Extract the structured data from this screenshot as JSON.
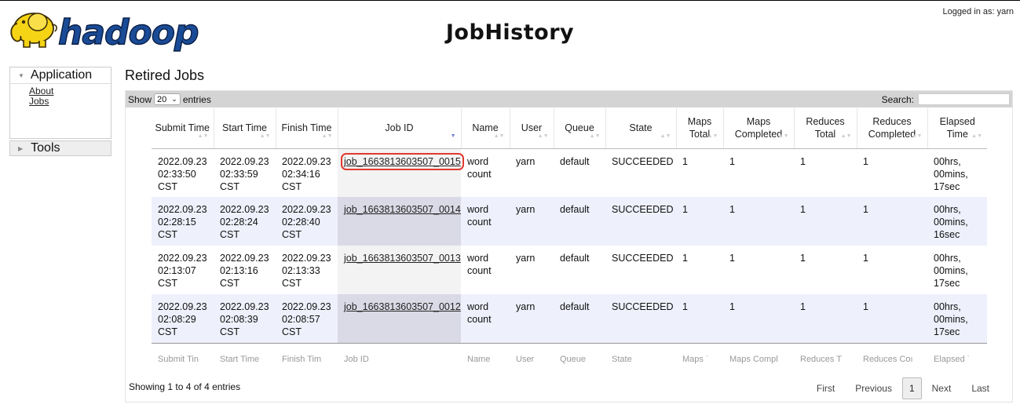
{
  "header": {
    "logo_text": "hadoop",
    "title": "JobHistory",
    "logged_in": "Logged in as: yarn"
  },
  "nav": {
    "application": "Application",
    "links": [
      "About",
      "Jobs"
    ],
    "tools": "Tools"
  },
  "main": {
    "title": "Retired Jobs",
    "show_label": "Show",
    "entries_value": "20",
    "entries_label": "entries",
    "search_label": "Search:"
  },
  "table": {
    "columns": [
      "Submit Time",
      "Start Time",
      "Finish Time",
      "Job ID",
      "Name",
      "User",
      "Queue",
      "State",
      "Maps Total",
      "Maps Completed",
      "Reduces Total",
      "Reduces Completed",
      "Elapsed Time"
    ],
    "footer": [
      "Submit Tin",
      "Start Time",
      "Finish Tim",
      "Job ID",
      "Name",
      "User",
      "Queue",
      "State",
      "Maps ˙",
      "Maps Compl",
      "Reduces T",
      "Reduces Coı",
      "Elapsed ˙"
    ],
    "rows": [
      {
        "submit": [
          "2022.09.23",
          "02:33:50",
          "CST"
        ],
        "start": [
          "2022.09.23",
          "02:33:59",
          "CST"
        ],
        "finish": [
          "2022.09.23",
          "02:34:16",
          "CST"
        ],
        "job_id": "job_1663813603507_0015",
        "name": [
          "word",
          "count"
        ],
        "user": "yarn",
        "queue": "default",
        "state": "SUCCEEDED",
        "maps_total": "1",
        "maps_completed": "1",
        "reduces_total": "1",
        "reduces_completed": "1",
        "elapsed": [
          "00hrs,",
          "00mins,",
          "17sec"
        ]
      },
      {
        "submit": [
          "2022.09.23",
          "02:28:15",
          "CST"
        ],
        "start": [
          "2022.09.23",
          "02:28:24",
          "CST"
        ],
        "finish": [
          "2022.09.23",
          "02:28:40",
          "CST"
        ],
        "job_id": "job_1663813603507_0014",
        "name": [
          "word",
          "count"
        ],
        "user": "yarn",
        "queue": "default",
        "state": "SUCCEEDED",
        "maps_total": "1",
        "maps_completed": "1",
        "reduces_total": "1",
        "reduces_completed": "1",
        "elapsed": [
          "00hrs,",
          "00mins,",
          "16sec"
        ]
      },
      {
        "submit": [
          "2022.09.23",
          "02:13:07",
          "CST"
        ],
        "start": [
          "2022.09.23",
          "02:13:16",
          "CST"
        ],
        "finish": [
          "2022.09.23",
          "02:13:33",
          "CST"
        ],
        "job_id": "job_1663813603507_0013",
        "name": [
          "word",
          "count"
        ],
        "user": "yarn",
        "queue": "default",
        "state": "SUCCEEDED",
        "maps_total": "1",
        "maps_completed": "1",
        "reduces_total": "1",
        "reduces_completed": "1",
        "elapsed": [
          "00hrs,",
          "00mins,",
          "17sec"
        ]
      },
      {
        "submit": [
          "2022.09.23",
          "02:08:29",
          "CST"
        ],
        "start": [
          "2022.09.23",
          "02:08:39",
          "CST"
        ],
        "finish": [
          "2022.09.23",
          "02:08:57",
          "CST"
        ],
        "job_id": "job_1663813603507_0012",
        "name": [
          "word",
          "count"
        ],
        "user": "yarn",
        "queue": "default",
        "state": "SUCCEEDED",
        "maps_total": "1",
        "maps_completed": "1",
        "reduces_total": "1",
        "reduces_completed": "1",
        "elapsed": [
          "00hrs,",
          "00mins,",
          "17sec"
        ]
      }
    ]
  },
  "info": "Showing 1 to 4 of 4 entries",
  "pager": {
    "first": "First",
    "previous": "Previous",
    "current": "1",
    "next": "Next",
    "last": "Last"
  },
  "colors": {
    "accent_highlight": "#e03a2e",
    "sort_active": "#6e7fd6",
    "logo_fill": "#1a4b96",
    "logo_yellow": "#f5d315"
  }
}
